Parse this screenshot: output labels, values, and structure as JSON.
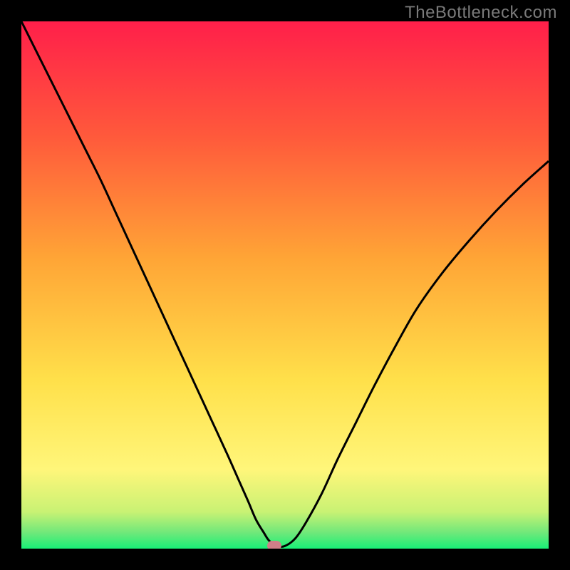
{
  "watermark": "TheBottleneck.com",
  "colors": {
    "bg_black": "#000000",
    "grad_top": "#ff1f4a",
    "grad_mid1": "#ff7a2f",
    "grad_mid2": "#ffd43a",
    "grad_low": "#fff67a",
    "grad_near_bottom": "#b6f06a",
    "grad_bottom": "#18f077",
    "curve": "#000000",
    "marker": "#cf7f88",
    "watermark_text": "#7a7a7a"
  },
  "chart_data": {
    "type": "line",
    "title": "",
    "xlabel": "",
    "ylabel": "",
    "xlim": [
      0,
      100
    ],
    "ylim": [
      0,
      100
    ],
    "note": "x is horizontal percent (0=left,100=right), y is bottleneck / mismatch percent (0=optimal bottom, 100=worst top). Values estimated from pixel positions.",
    "series": [
      {
        "name": "bottleneck-curve",
        "x": [
          0,
          3,
          6,
          9,
          12,
          15,
          18,
          21,
          24,
          27,
          30,
          33,
          36,
          39,
          41,
          43,
          44.5,
          46,
          47,
          48.5,
          50,
          52,
          54,
          57,
          60,
          63.5,
          67,
          71,
          75,
          80,
          85,
          90,
          95,
          100
        ],
        "y": [
          100,
          94,
          88,
          82,
          76,
          70,
          63.5,
          57,
          50.5,
          44,
          37.5,
          31,
          24.5,
          18,
          13.5,
          9,
          5.5,
          3,
          1.5,
          0.5,
          0.5,
          2,
          5,
          10.5,
          17,
          24,
          31,
          38.5,
          45.5,
          52.5,
          58.5,
          64,
          69,
          73.5
        ]
      }
    ],
    "marker": {
      "x": 48,
      "y": 0.5,
      "label": "optimal-point"
    },
    "gradient_stops": [
      {
        "offset": 0.0,
        "color": "#ff1f4a"
      },
      {
        "offset": 0.22,
        "color": "#ff5a3b"
      },
      {
        "offset": 0.45,
        "color": "#ffa536"
      },
      {
        "offset": 0.68,
        "color": "#ffe04a"
      },
      {
        "offset": 0.85,
        "color": "#fff67a"
      },
      {
        "offset": 0.93,
        "color": "#c9f274"
      },
      {
        "offset": 0.97,
        "color": "#6fe87a"
      },
      {
        "offset": 1.0,
        "color": "#18f077"
      }
    ]
  }
}
